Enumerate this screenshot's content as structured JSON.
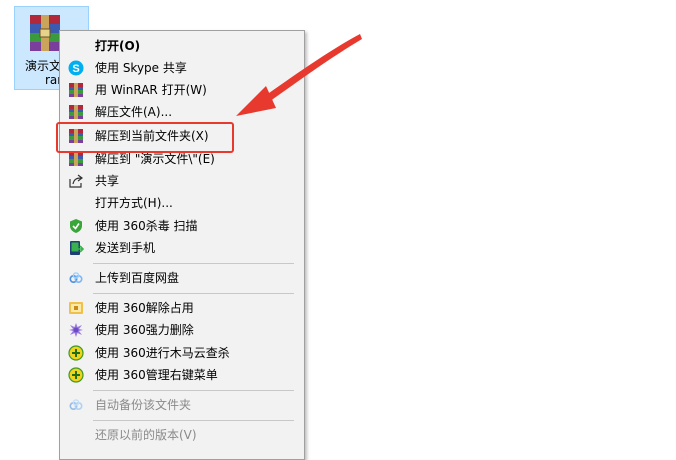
{
  "desktop_icon": {
    "label_line1": "演示文",
    "label_line2": "rar"
  },
  "menu": {
    "items": [
      {
        "label": "打开(O)",
        "icon": "none"
      },
      {
        "label": "使用 Skype 共享",
        "icon": "skype-icon"
      },
      {
        "label": "用 WinRAR 打开(W)",
        "icon": "winrar-icon"
      },
      {
        "label": "解压文件(A)...",
        "icon": "winrar-icon"
      },
      {
        "label": "解压到当前文件夹(X)",
        "icon": "winrar-icon"
      },
      {
        "label": "解压到 \"演示文件\\\"(E)",
        "icon": "winrar-icon"
      },
      {
        "label": "共享",
        "icon": "share-icon"
      },
      {
        "label": "打开方式(H)...",
        "icon": "none"
      },
      {
        "label": "使用 360杀毒 扫描",
        "icon": "360-shield-icon"
      },
      {
        "label": "发送到手机",
        "icon": "phone-icon"
      },
      {
        "label": "上传到百度网盘",
        "icon": "baidu-cloud-icon"
      },
      {
        "label": "使用 360解除占用",
        "icon": "360-unlock-icon"
      },
      {
        "label": "使用 360强力删除",
        "icon": "360-delete-icon"
      },
      {
        "label": "使用 360进行木马云查杀",
        "icon": "360-scan-icon"
      },
      {
        "label": "使用 360管理右键菜单",
        "icon": "360-menu-icon"
      },
      {
        "label": "自动备份该文件夹",
        "icon": "baidu-cloud-icon"
      },
      {
        "label": "还原以前的版本(V)",
        "icon": "none"
      }
    ]
  },
  "colors": {
    "highlight": "#e8392f",
    "arrow": "#e8392f",
    "menu_bg": "#f2f2f2",
    "selection_bg": "#cce8ff"
  }
}
